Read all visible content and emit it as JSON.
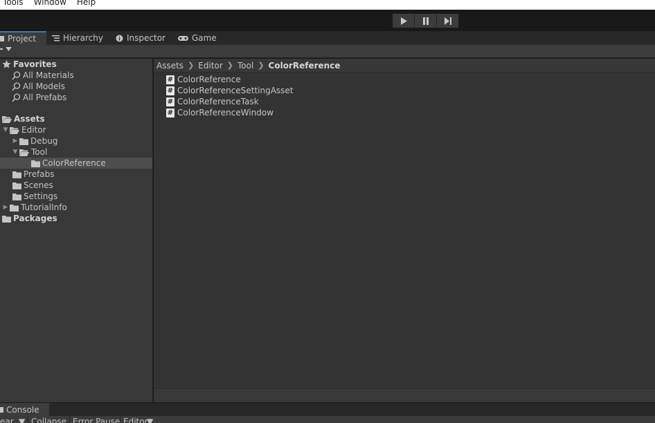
{
  "menu": [
    "Tools",
    "Window",
    "Help"
  ],
  "tabs": [
    {
      "label": "Project",
      "icon": "folder-icon",
      "active": true
    },
    {
      "label": "Hierarchy",
      "icon": "list-icon",
      "active": false
    },
    {
      "label": "Inspector",
      "icon": "info-icon",
      "active": false
    },
    {
      "label": "Game",
      "icon": "gamepad-icon",
      "active": false
    }
  ],
  "tree": {
    "favorites_label": "Favorites",
    "favorites": [
      "All Materials",
      "All Models",
      "All Prefabs"
    ],
    "assets_label": "Assets",
    "editor": "Editor",
    "debug": "Debug",
    "tool": "Tool",
    "colorreference": "ColorReference",
    "prefabs": "Prefabs",
    "scenes": "Scenes",
    "settings": "Settings",
    "tutorialinfo": "TutorialInfo",
    "packages_label": "Packages"
  },
  "breadcrumb": [
    "Assets",
    "Editor",
    "Tool",
    "ColorReference"
  ],
  "files": [
    "ColorReference",
    "ColorReferenceSettingAsset",
    "ColorReferenceTask",
    "ColorReferenceWindow"
  ],
  "file_icon_glyph": "#",
  "console": {
    "tab": "Console",
    "tools": [
      "ear",
      "Collapse",
      "Error Pause",
      "Editor"
    ]
  },
  "colors": {
    "accent": "#3a79bb",
    "selection": "#4d4d4d"
  }
}
